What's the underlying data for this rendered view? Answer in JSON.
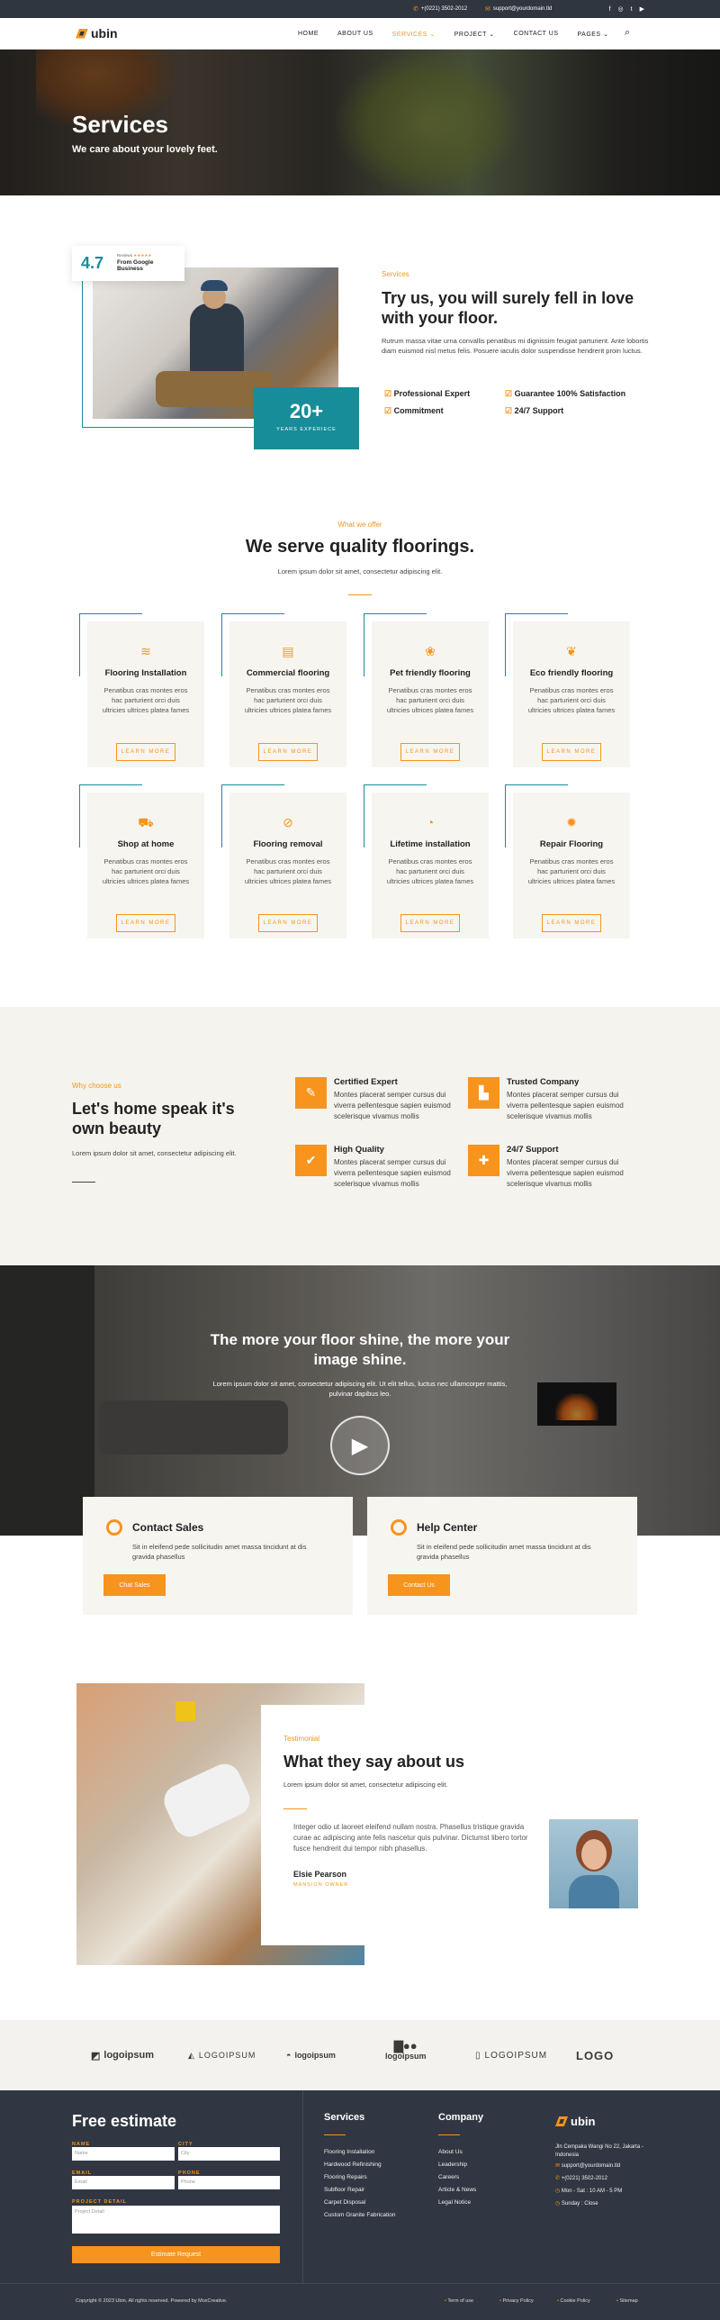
{
  "topbar": {
    "phone": "+(0221) 3502-2012",
    "email": "support@yourdomain.tld",
    "social": [
      "facebook-icon",
      "instagram-icon",
      "twitter-icon",
      "youtube-icon"
    ]
  },
  "nav": {
    "brand": "ubin",
    "items": [
      "HOME",
      "ABOUT US",
      "SERVICES",
      "PROJECT",
      "CONTACT US",
      "PAGES"
    ],
    "active": "SERVICES"
  },
  "hero": {
    "title": "Services",
    "subtitle": "We care about your lovely feet."
  },
  "about": {
    "rating": "4.7",
    "reviews_label": "Reviews",
    "review_source": "From Google Business",
    "years": "20+",
    "years_label": "YEARS EXPERIECE",
    "kicker": "Services",
    "heading": "Try us, you will surely fell in love with your floor.",
    "body": "Rutrum massa vitae urna convallis penatibus mi dignissim feugiat parturient. Ante lobortis diam euismod nisl metus felis. Posuere iaculis dolor suspendisse hendrerit proin luctus.",
    "checks": [
      "Professional Expert",
      "Guarantee 100% Satisfaction",
      "Commitment",
      "24/7 Support"
    ]
  },
  "offer": {
    "kicker": "What we offer",
    "heading": "We serve quality floorings.",
    "sub": "Lorem ipsum dolor sit amet, consectetur adipiscing elit.",
    "card_body": "Penatibus cras montes eros hac parturient orci duis ultricies ultrices platea fames",
    "button": "LEARN MORE",
    "cards": [
      {
        "title": "Flooring Installation",
        "icon": "layers-icon",
        "glyph": "≋"
      },
      {
        "title": "Commercial flooring",
        "icon": "store-icon",
        "glyph": "▤"
      },
      {
        "title": "Pet friendly flooring",
        "icon": "paw-icon",
        "glyph": "❀"
      },
      {
        "title": "Eco friendly flooring",
        "icon": "leaf-icon",
        "glyph": "❦"
      },
      {
        "title": "Shop at home",
        "icon": "cart-icon",
        "glyph": "⛟"
      },
      {
        "title": "Flooring removal",
        "icon": "remove-icon",
        "glyph": "⊘"
      },
      {
        "title": "Lifetime installation",
        "icon": "clock-icon",
        "glyph": "◔"
      },
      {
        "title": "Repair Flooring",
        "icon": "gear-icon",
        "glyph": "✹"
      }
    ]
  },
  "why": {
    "kicker": "Why choose us",
    "heading": "Let's home speak it's own beauty",
    "sub": "Lorem ipsum dolor sit amet, consectetur adipiscing elit.",
    "feat_body": "Montes placerat semper cursus dui viverra pellentesque sapien euismod scelerisque vivamus mollis",
    "features": [
      {
        "title": "Certified Expert",
        "icon": "expert-icon",
        "glyph": "✎"
      },
      {
        "title": "Trusted Company",
        "icon": "company-icon",
        "glyph": "▙"
      },
      {
        "title": "High Quality",
        "icon": "quality-icon",
        "glyph": "✔"
      },
      {
        "title": "24/7 Support",
        "icon": "support-icon",
        "glyph": "✚"
      }
    ]
  },
  "video": {
    "heading": "The more your floor shine, the more your image shine.",
    "sub": "Lorem ipsum dolor sit amet, consectetur adipiscing elit. Ut elit tellus, luctus nec ullamcorper mattis, pulvinar dapibus leo."
  },
  "contact": [
    {
      "title": "Contact Sales",
      "body": "Sit in eleifend pede sollicitudin amet massa tincidunt at dis gravida phasellus",
      "button": "Chat Sales"
    },
    {
      "title": "Help Center",
      "body": "Sit in eleifend pede sollicitudin amet massa tincidunt at dis gravida phasellus",
      "button": "Contact Us"
    }
  ],
  "testimonial": {
    "kicker": "Testimonial",
    "heading": "What they say about us",
    "sub": "Lorem ipsum dolor sit amet, consectetur adipiscing elit.",
    "quote": "Integer odio ut laoreet eleifend nullam nostra. Phasellus tristique gravida curae ac adipiscing ante felis nascetur quis pulvinar. Dictumst libero tortor fusce hendrerit dui tempor nibh phasellus.",
    "name": "Elsie Pearson",
    "role": "MANSION OWNER"
  },
  "logos": [
    "logoipsum",
    "LOGOIPSUM",
    "logoipsum",
    "logoipsum",
    "LOGOIPSUM",
    "LOGO"
  ],
  "footer": {
    "form_title": "Free estimate",
    "labels": {
      "name": "NAME",
      "city": "CITY",
      "email": "EMAIL",
      "phone": "PHONE",
      "detail": "PROJECT DETAIL"
    },
    "placeholders": {
      "name": "Name",
      "city": "City",
      "email": "Email",
      "phone": "Phone",
      "detail": "Project Detail"
    },
    "submit": "Estimate Request",
    "services_title": "Services",
    "services": [
      "Flooring Installation",
      "Hardwood Refinishing",
      "Flooring Repairs",
      "Subfloor Repair",
      "Carpet Disposal",
      "Custom Granite Fabrication"
    ],
    "company_title": "Company",
    "company": [
      "About Us",
      "Leadership",
      "Careers",
      "Article & News",
      "Legal Notice"
    ],
    "brand": "ubin",
    "address": "Jln Cempaka Wangi No 22, Jakarta - Indonesia",
    "email": "support@yourdomain.tld",
    "phone": "+(0221) 3502-2012",
    "hours": "Mon - Sat : 10 AM - 5 PM",
    "closed": "Sunday : Close",
    "copyright": "Copyright © 2023 Ubin, All rights reserved. Powered by MoxCreative.",
    "legal": [
      "Term of use",
      "Privacy Policy",
      "Cookie Policy",
      "Sitemap"
    ]
  }
}
